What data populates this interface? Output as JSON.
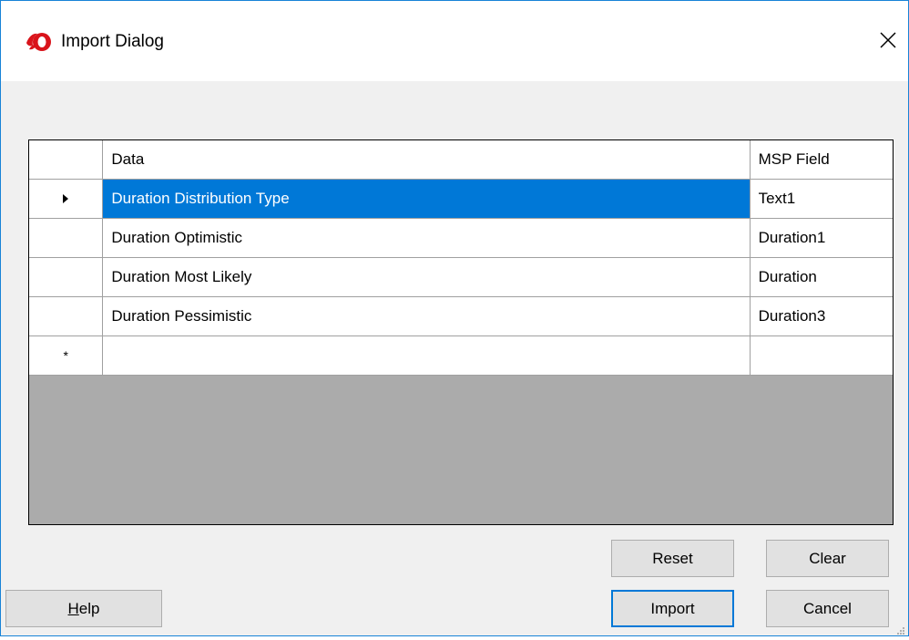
{
  "window": {
    "title": "Import Dialog",
    "close_icon": "close-icon",
    "app_icon": "app-logo-icon"
  },
  "grid": {
    "columns": [
      "Data",
      "MSP Field"
    ],
    "rows": [
      {
        "data": "Duration Distribution Type",
        "msp_field": "Text1",
        "selected": true
      },
      {
        "data": "Duration Optimistic",
        "msp_field": "Duration1"
      },
      {
        "data": "Duration Most Likely",
        "msp_field": "Duration"
      },
      {
        "data": "Duration Pessimistic",
        "msp_field": "Duration3"
      }
    ],
    "current_row_marker": "▶",
    "new_row_marker": "*",
    "selection_color": "#0078d7"
  },
  "buttons": {
    "reset": "Reset",
    "clear": "Clear",
    "help_prefix": "H",
    "help_rest": "elp",
    "import": "Import",
    "cancel": "Cancel"
  }
}
